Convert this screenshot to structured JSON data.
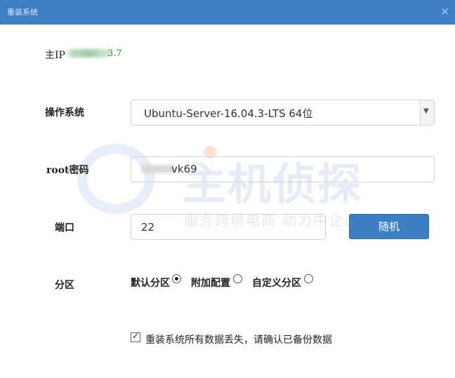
{
  "window": {
    "title": "重装系统",
    "close_glyph": "×"
  },
  "watermark": {
    "brand": "主机侦探",
    "slogan": "服务跨境电商 助力中企出海"
  },
  "main_ip": {
    "label": "主IP",
    "value_suffix": "3.7",
    "value_color": "#2f8a3b"
  },
  "os": {
    "label": "操作系统",
    "selected": "Ubuntu-Server-16.04.3-LTS 64位"
  },
  "password": {
    "label": "root密码",
    "value_suffix": "vk69"
  },
  "port": {
    "label": "端口",
    "value": "22",
    "random_button": "随机"
  },
  "partition": {
    "label": "分区",
    "options": [
      {
        "label": "默认分区",
        "checked": true
      },
      {
        "label": "附加配置",
        "checked": false
      },
      {
        "label": "自定义分区",
        "checked": false
      }
    ]
  },
  "confirm": {
    "checked": true,
    "text": "重装系统所有数据丢失，请确认已备份数据"
  },
  "colors": {
    "titlebar": "#3f7fc4",
    "primary_button": "#3b7fc2"
  }
}
